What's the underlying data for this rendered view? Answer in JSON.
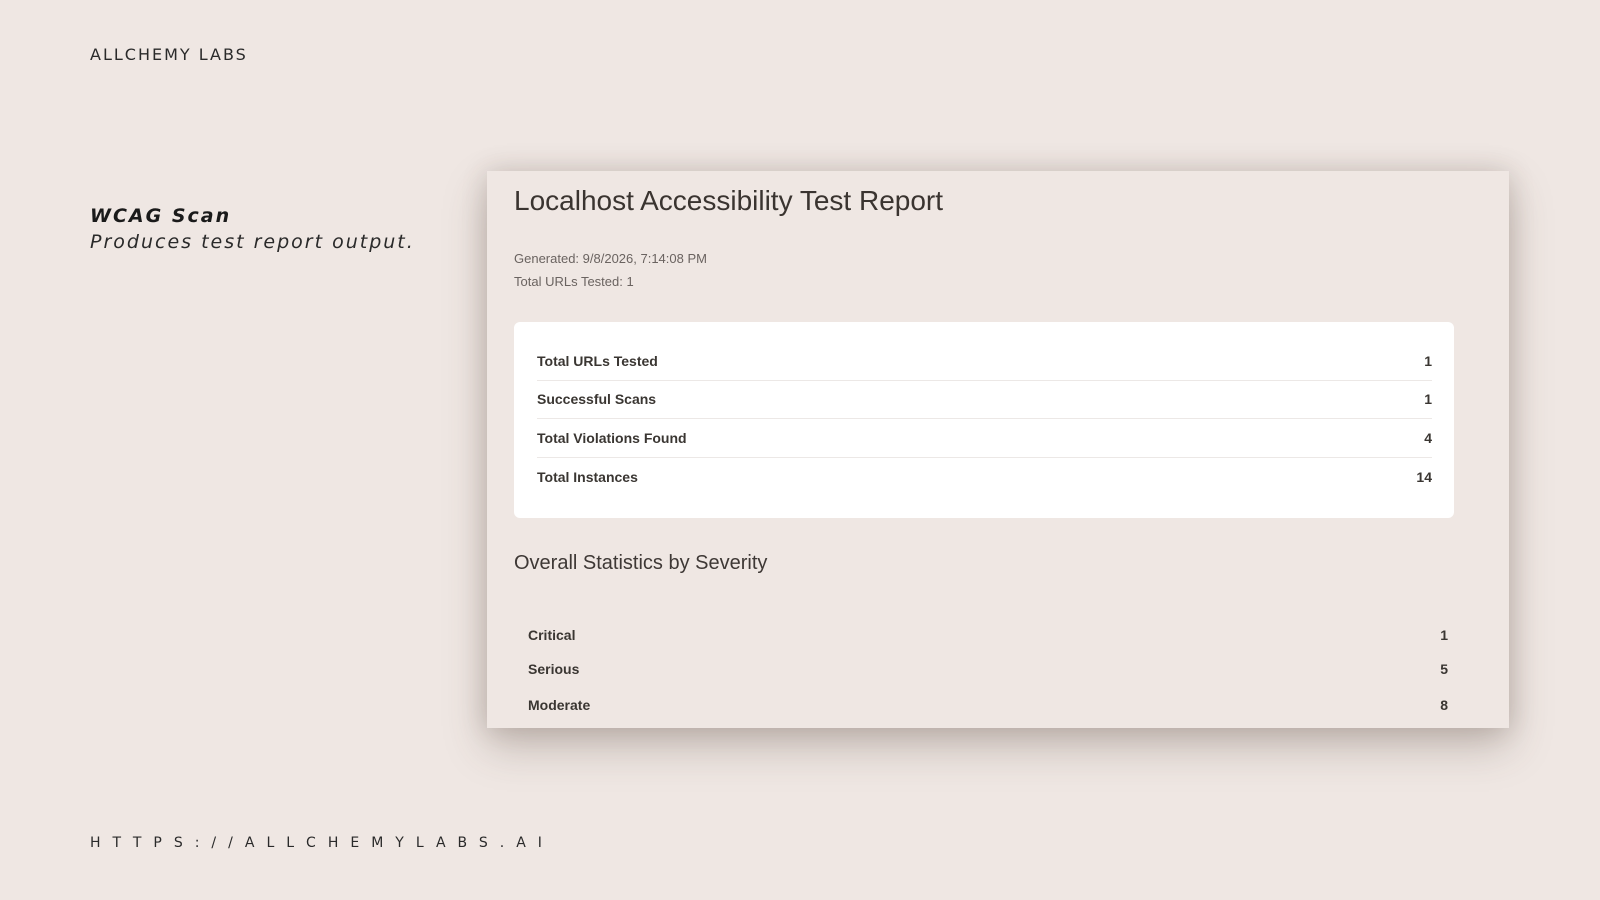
{
  "brand": "ALLCHEMY LABS",
  "caption": {
    "title": "WCAG Scan",
    "subtitle": "Produces test report output."
  },
  "footer_url": "HTTPS://ALLCHEMYLABS.AI",
  "report": {
    "title": "Localhost Accessibility Test Report",
    "generated": "Generated: 9/8/2026, 7:14:08 PM",
    "total_urls_line": "Total URLs Tested: 1",
    "summary": [
      {
        "label": "Total URLs Tested",
        "value": "1"
      },
      {
        "label": "Successful Scans",
        "value": "1"
      },
      {
        "label": "Total Violations Found",
        "value": "4"
      },
      {
        "label": "Total Instances",
        "value": "14"
      }
    ],
    "severity_title": "Overall Statistics by Severity",
    "severity": [
      {
        "label": "Critical",
        "value": "1"
      },
      {
        "label": "Serious",
        "value": "5"
      },
      {
        "label": "Moderate",
        "value": "8"
      }
    ]
  }
}
